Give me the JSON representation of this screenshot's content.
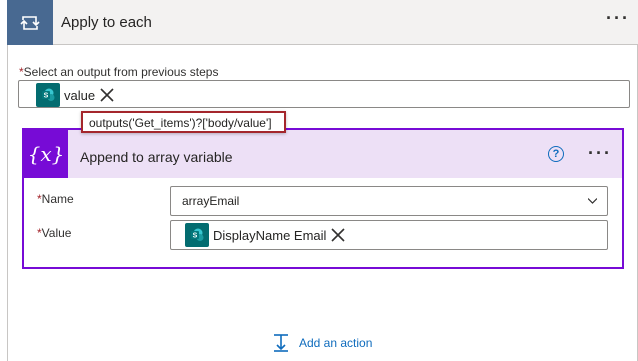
{
  "loop": {
    "title": "Apply to each",
    "more_label": "···"
  },
  "select_output": {
    "required_mark": "*",
    "label": "Select an output from previous steps",
    "token_text": "value"
  },
  "tooltip": {
    "expression": "outputs('Get_items')?['body/value']"
  },
  "action": {
    "title": "Append to array variable",
    "help_label": "?",
    "more_label": "···",
    "icon_text": "{x}",
    "name_field": {
      "required_mark": "*",
      "label": "Name",
      "value": "arrayEmail"
    },
    "value_field": {
      "required_mark": "*",
      "label": "Value",
      "token_text": "DisplayName Email"
    }
  },
  "add_action": {
    "label": "Add an action"
  },
  "colors": {
    "loop_accent": "#486991",
    "variable_accent": "#770bd6",
    "variable_header_bg": "#ede0f6",
    "sharepoint_token": "#036c70",
    "link_blue": "#0f6cbd",
    "highlight_red": "#a4262c"
  },
  "icons": {
    "loop": "loop-icon",
    "variable": "variable-icon",
    "sharepoint": "sharepoint-icon",
    "remove": "close-icon",
    "help": "help-icon",
    "dropdown": "chevron-down-icon",
    "add_action": "add-action-icon"
  }
}
